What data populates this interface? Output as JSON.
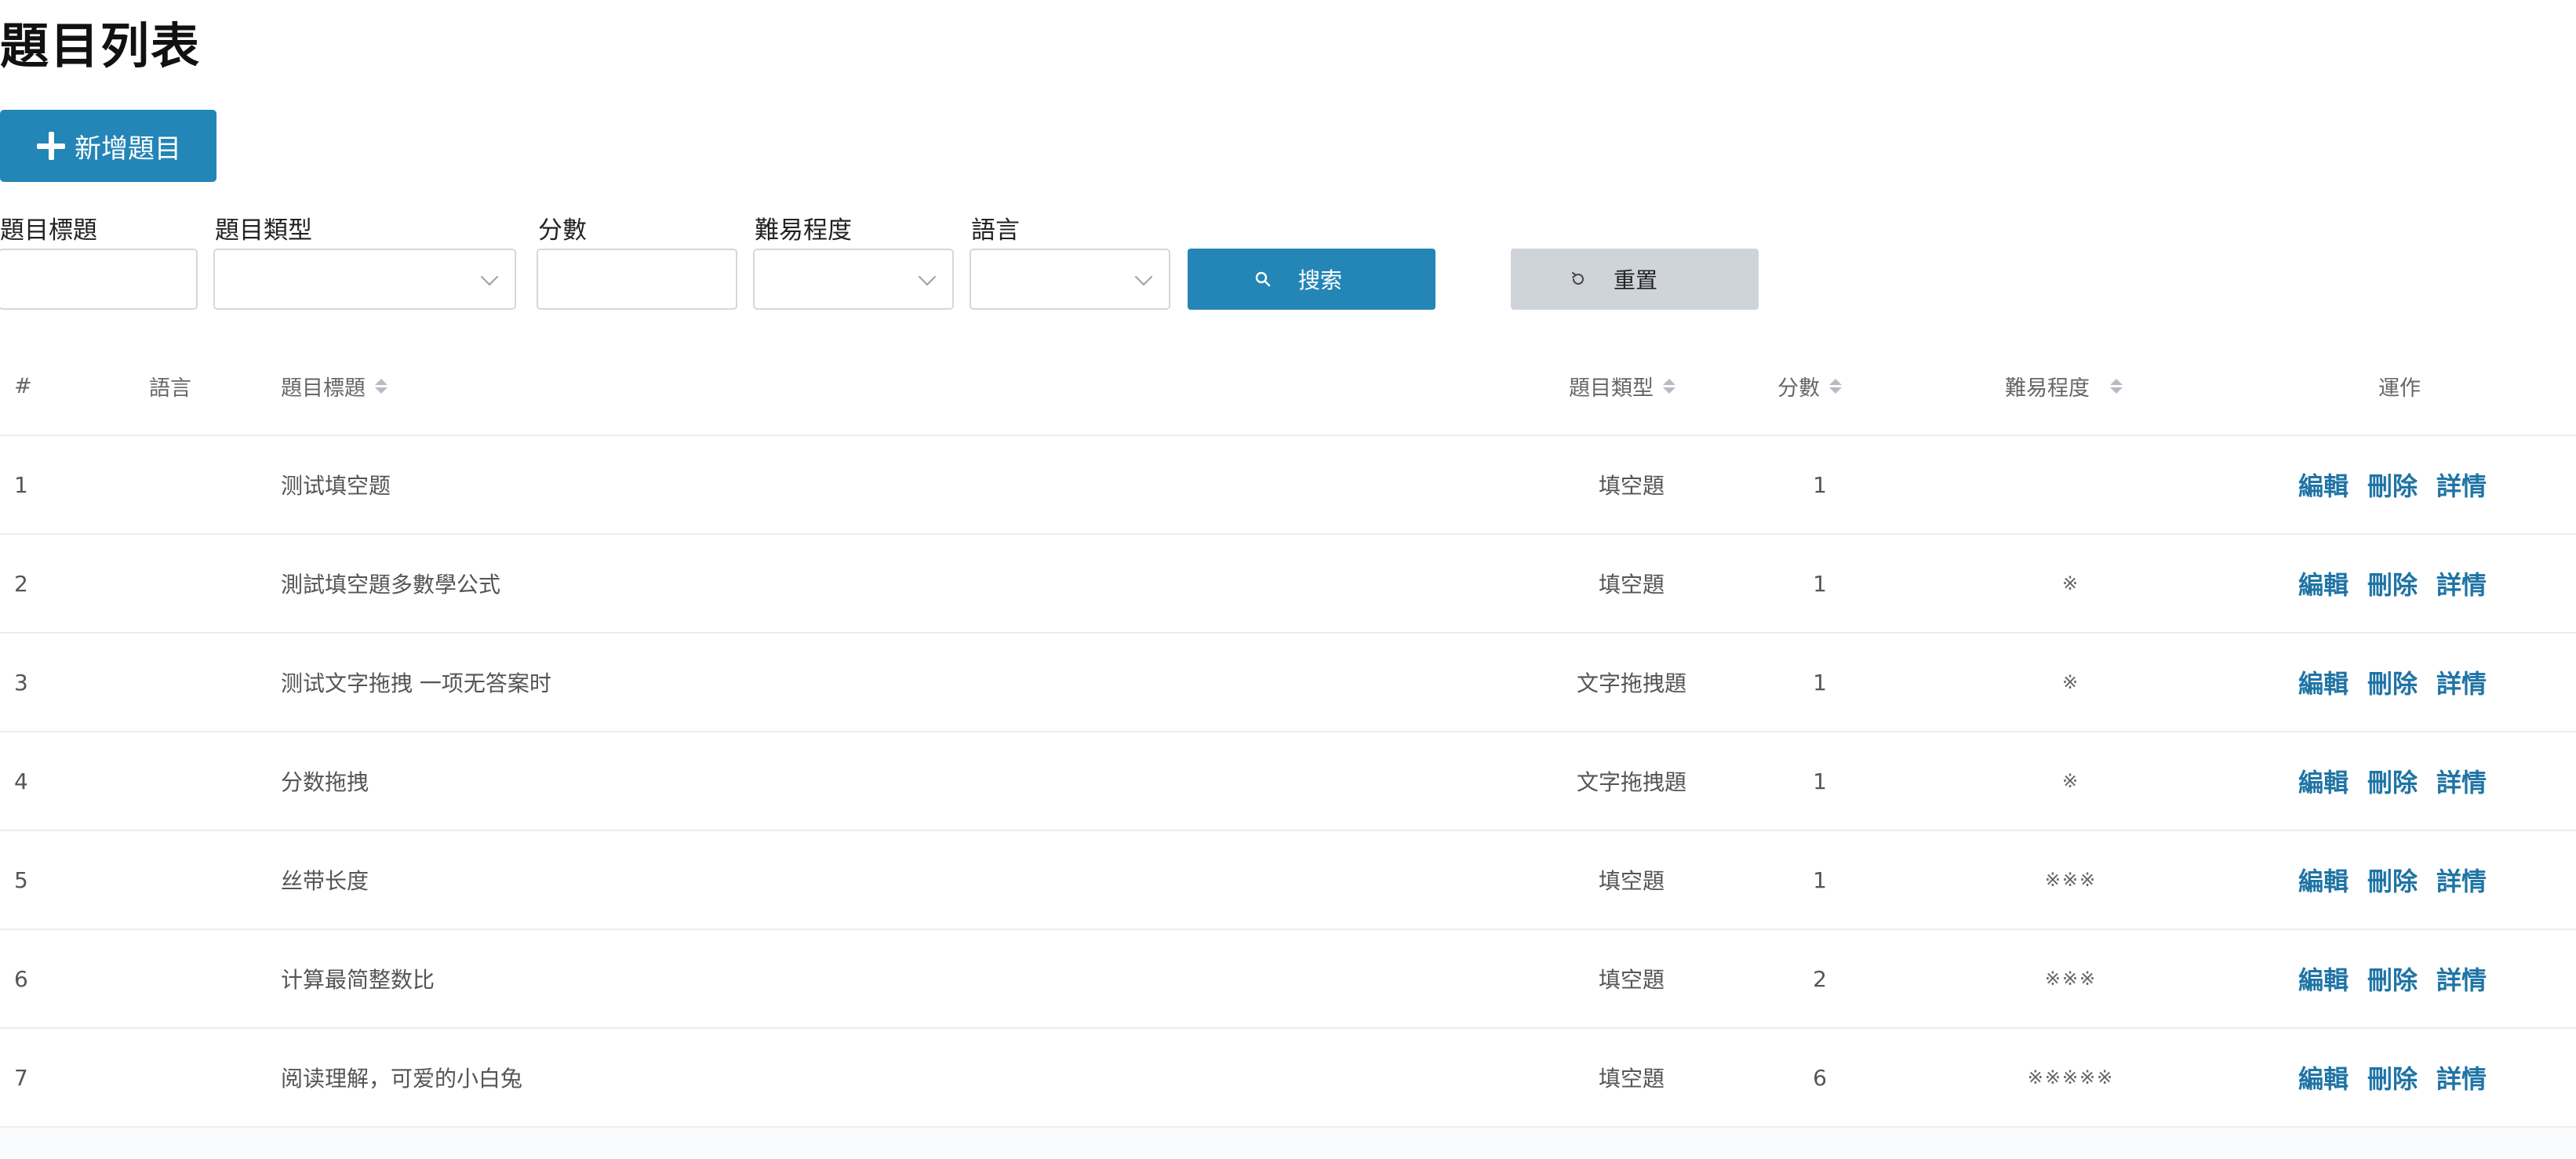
{
  "page": {
    "title": "題目列表",
    "add_button_label": "新增題目"
  },
  "filters": {
    "title_label": "題目標題",
    "type_label": "題目類型",
    "score_label": "分數",
    "difficulty_label": "難易程度",
    "language_label": "語言",
    "title_value": "",
    "type_value": "",
    "score_value": "",
    "difficulty_value": "",
    "language_value": "",
    "search_label": "搜索",
    "reset_label": "重置"
  },
  "icons": {
    "add": "plus-icon",
    "search": "search-icon",
    "reset": "refresh-icon",
    "dropdown": "chevron-down-icon",
    "sort": "sort-icon"
  },
  "colors": {
    "primary": "#2485b7",
    "link": "#1f74a5",
    "reset_bg": "#cfd3da"
  },
  "table": {
    "headers": {
      "index": "#",
      "language": "語言",
      "title": "題目標題",
      "type": "題目類型",
      "score": "分數",
      "difficulty": "難易程度",
      "actions": "運作"
    },
    "actions": {
      "edit": "編輯",
      "delete": "刪除",
      "detail": "詳情"
    },
    "rows": [
      {
        "index": "1",
        "language": "",
        "title": "测试填空题",
        "type": "填空題",
        "score": "1",
        "difficulty": ""
      },
      {
        "index": "2",
        "language": "",
        "title": "測試填空題多數學公式",
        "type": "填空題",
        "score": "1",
        "difficulty": "※"
      },
      {
        "index": "3",
        "language": "",
        "title": "测试文字拖拽 一项无答案时",
        "type": "文字拖拽題",
        "score": "1",
        "difficulty": "※"
      },
      {
        "index": "4",
        "language": "",
        "title": "分数拖拽",
        "type": "文字拖拽題",
        "score": "1",
        "difficulty": "※"
      },
      {
        "index": "5",
        "language": "",
        "title": "丝带长度",
        "type": "填空題",
        "score": "1",
        "difficulty": "※※※"
      },
      {
        "index": "6",
        "language": "",
        "title": "计算最简整数比",
        "type": "填空題",
        "score": "2",
        "difficulty": "※※※"
      },
      {
        "index": "7",
        "language": "",
        "title": "阅读理解，可爱的小白兔",
        "type": "填空題",
        "score": "6",
        "difficulty": "※※※※※"
      }
    ]
  }
}
